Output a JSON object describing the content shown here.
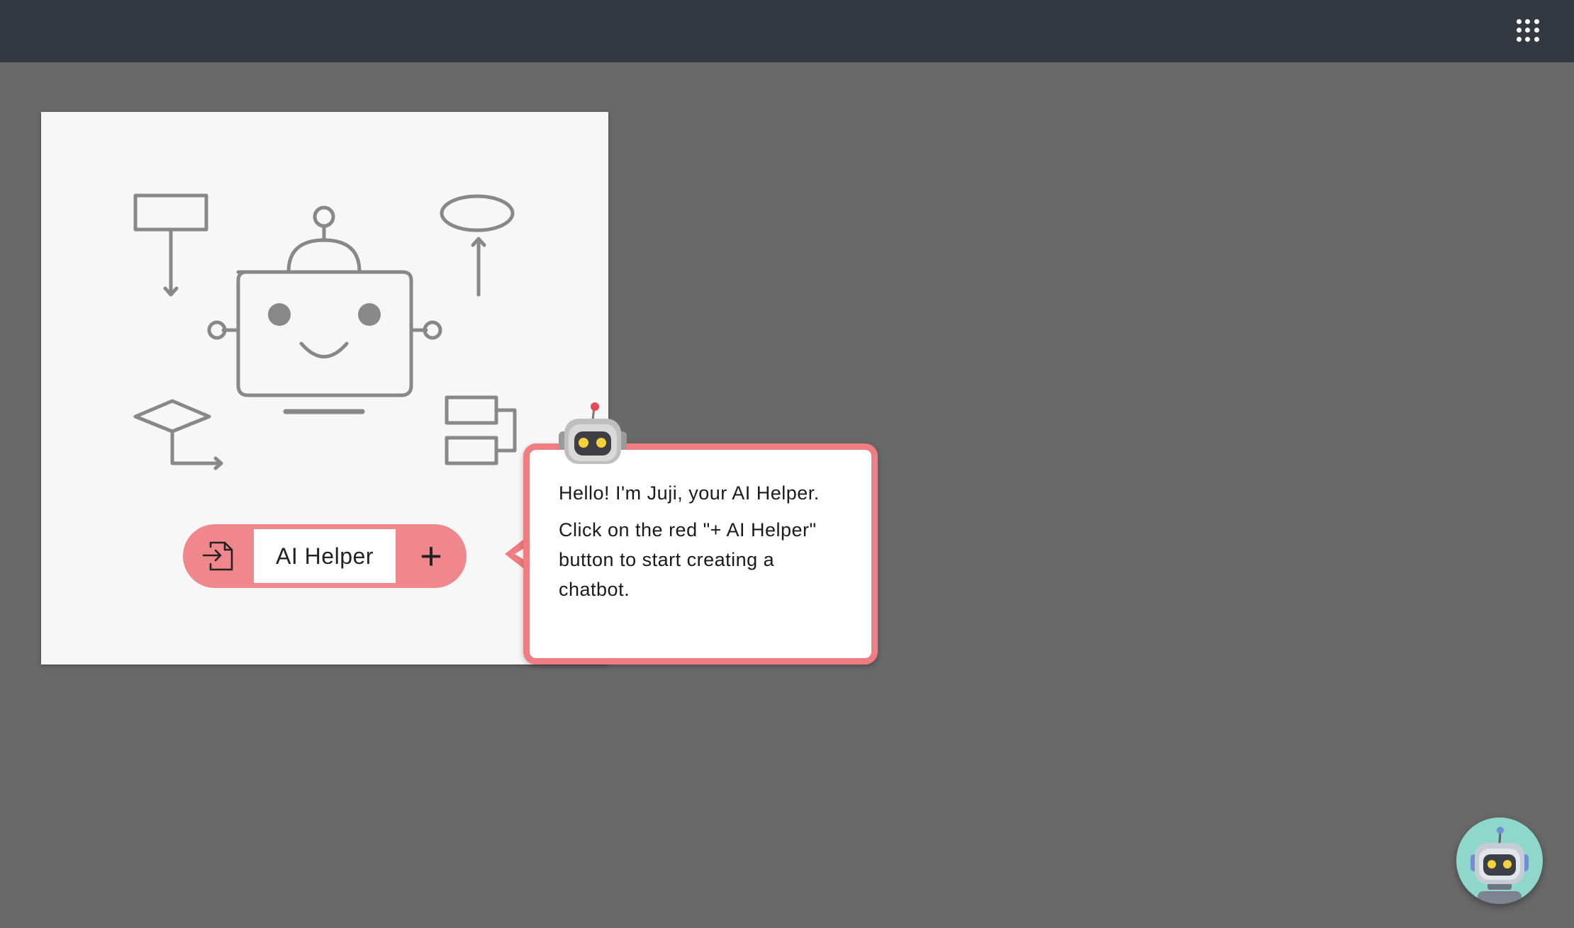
{
  "topbar": {
    "apps_icon": "apps-grid-icon"
  },
  "card": {
    "ai_button": {
      "import_icon": "import-file-icon",
      "label": "AI Helper",
      "add_icon": "plus-icon",
      "add_symbol": "+"
    }
  },
  "tooltip": {
    "line1": "Hello! I'm Juji, your AI Helper.",
    "line2": "Click on the red \"+ AI Helper\" button to start creating a chatbot."
  },
  "colors": {
    "topbar": "#343841",
    "background": "#696969",
    "accent": "#ef878c",
    "bubble_border": "#ef7d82",
    "fab": "#8fd6cb",
    "illustration": "#888888"
  }
}
